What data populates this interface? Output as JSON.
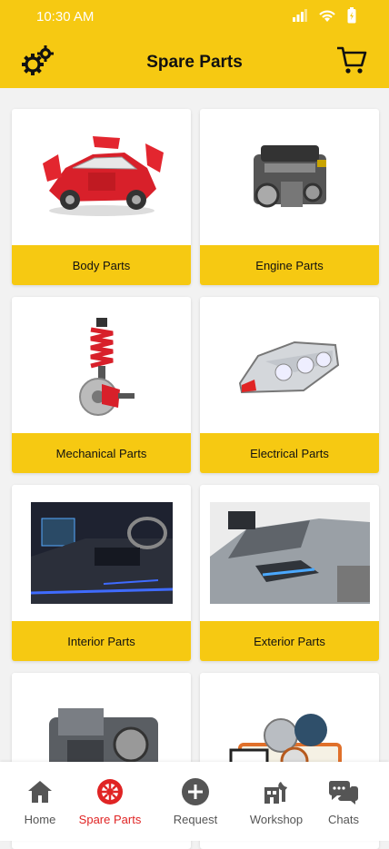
{
  "status": {
    "time": "10:30 AM"
  },
  "header": {
    "title": "Spare Parts",
    "accent": "#f6c912"
  },
  "categories": [
    {
      "label": "Body Parts"
    },
    {
      "label": "Engine Parts"
    },
    {
      "label": "Mechanical Parts"
    },
    {
      "label": "Electrical Parts"
    },
    {
      "label": "Interior Parts"
    },
    {
      "label": "Exterior Parts"
    }
  ],
  "nav": {
    "items": [
      {
        "label": "Home",
        "icon": "home-icon"
      },
      {
        "label": "Spare Parts",
        "icon": "wheel-icon"
      },
      {
        "label": "Request",
        "icon": "plus-circle-icon"
      },
      {
        "label": "Workshop",
        "icon": "workshop-icon"
      },
      {
        "label": "Chats",
        "icon": "chat-icon"
      }
    ],
    "active_color": "#e02424"
  }
}
